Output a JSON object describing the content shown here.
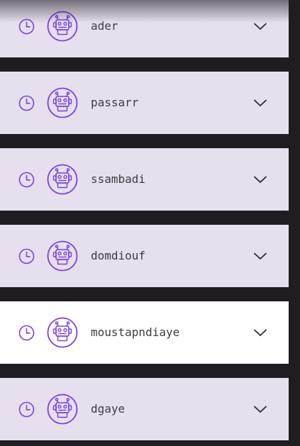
{
  "colors": {
    "accent": "#7b3fe4",
    "row_default": "#e6e0ee",
    "row_highlighted": "#ffffff",
    "background": "#1f1d21",
    "text": "#3d3b41"
  },
  "icons": {
    "status": "clock-icon",
    "avatar": "robot-icon",
    "expand": "chevron-down-icon"
  },
  "rows": [
    {
      "username": "ader",
      "highlighted": false
    },
    {
      "username": "passarr",
      "highlighted": false
    },
    {
      "username": "ssambadi",
      "highlighted": false
    },
    {
      "username": "domdiouf",
      "highlighted": false
    },
    {
      "username": "moustapndiaye",
      "highlighted": true
    },
    {
      "username": "dgaye",
      "highlighted": false
    }
  ]
}
